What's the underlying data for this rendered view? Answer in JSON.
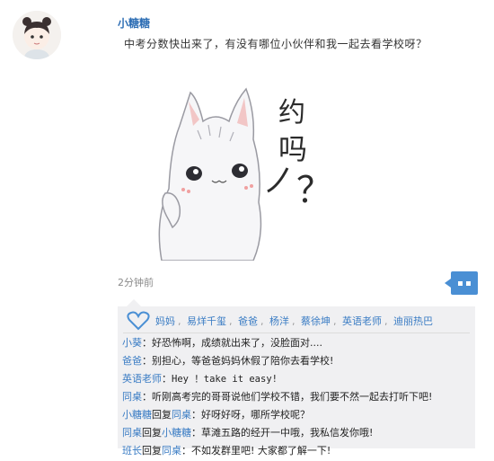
{
  "post": {
    "username": "小糖糖",
    "text": "中考分数快出来了，有没有哪位小伙伴和我一起去看学校呀？",
    "timestamp": "2分钟前"
  },
  "sticker": {
    "text_line1": "约",
    "text_line2": "吗",
    "text_line3": "？"
  },
  "likes": [
    "妈妈",
    "易烊千玺",
    "爸爸",
    "杨洋",
    "蔡徐坤",
    "英语老师",
    "迪丽热巴"
  ],
  "comments": [
    {
      "from": "小葵",
      "reply_word": "",
      "to": "",
      "colon": "：",
      "text": "好恐怖啊，成绩就出来了，没脸面对...."
    },
    {
      "from": "爸爸",
      "reply_word": "",
      "to": "",
      "colon": "：",
      "text": "别担心，等爸爸妈妈休假了陪你去看学校!"
    },
    {
      "from": "英语老师",
      "reply_word": "",
      "to": "",
      "colon": "：",
      "text": "Hey ！take it easy!"
    },
    {
      "from": "同桌",
      "reply_word": "",
      "to": "",
      "colon": "：",
      "text": "听刚高考完的哥哥说他们学校不错，我们要不然一起去打听下吧!"
    },
    {
      "from": "小糖糖",
      "reply_word": "回复",
      "to": "同桌",
      "colon": "：",
      "text": "好呀好呀，哪所学校呢？"
    },
    {
      "from": "同桌",
      "reply_word": "回复",
      "to": "小糖糖",
      "colon": "：",
      "text": "草滩五路的经开一中哦，我私信发你哦!"
    },
    {
      "from": "班长",
      "reply_word": "回复",
      "to": "同桌",
      "colon": "：",
      "text": "不如发群里吧! 大家都了解一下!"
    }
  ],
  "colors": {
    "accent_blue": "#3a7cc4",
    "comment_bg": "#f0f0f2",
    "comment_button": "#4a8fd4"
  }
}
